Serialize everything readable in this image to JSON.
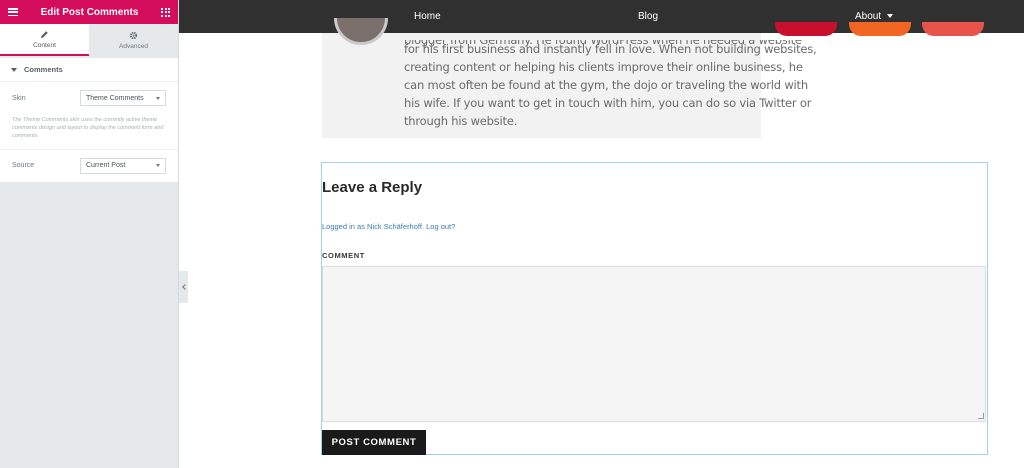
{
  "panel": {
    "title": "Edit Post Comments",
    "tabs": [
      {
        "label": "Content",
        "icon": "pencil-icon"
      },
      {
        "label": "Advanced",
        "icon": "gear-icon"
      }
    ],
    "section": {
      "title": "Comments"
    },
    "controls": {
      "skin": {
        "label": "Skin",
        "value": "Theme Comments"
      },
      "skin_description": "The Theme Comments skin uses the currently active theme comments design and layout to display the comment form and comments.",
      "source": {
        "label": "Source",
        "value": "Current Post"
      }
    },
    "accent": "#d30c5c"
  },
  "nav": {
    "items": [
      {
        "label": "Home"
      },
      {
        "label": "Blog"
      },
      {
        "label": "About"
      }
    ]
  },
  "author": {
    "bio_lines": [
      "blogger from Germany. He found WordPress when he needed a website",
      "for his first business and instantly fell in love. When not building websites,",
      "creating content or helping his clients improve their online business, he",
      "can most often be found at the gym, the dojo or traveling the world with",
      "his wife. If you want to get in touch with him, you can do so via Twitter or",
      "through his website."
    ]
  },
  "social_colors": [
    "#c8102e",
    "#f26522",
    "#e8534a"
  ],
  "comments": {
    "title": "Leave a Reply",
    "logged_in_prefix": "Logged in as ",
    "user_name": "Nick Schäferhoff",
    "logout_label": "Log out?",
    "comment_label": "COMMENT",
    "submit_label": "POST COMMENT"
  }
}
